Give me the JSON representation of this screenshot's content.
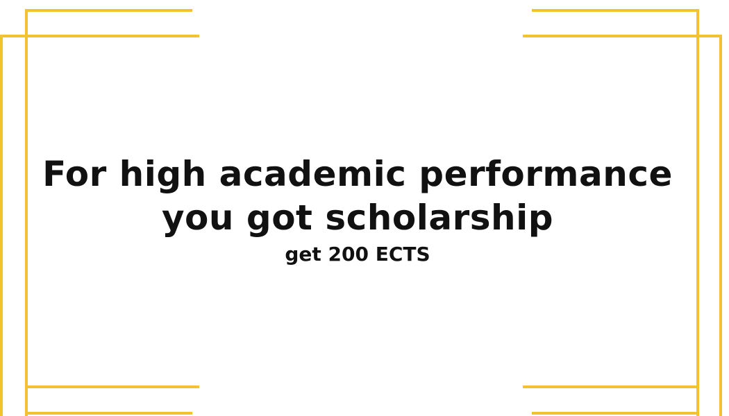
{
  "headline": {
    "line1": "For high academic performance",
    "line2": "you got scholarship"
  },
  "reward": "get 200 ECTS",
  "colors": {
    "background": "#ffffff",
    "frame": "#f2c230",
    "text": "#111111"
  }
}
